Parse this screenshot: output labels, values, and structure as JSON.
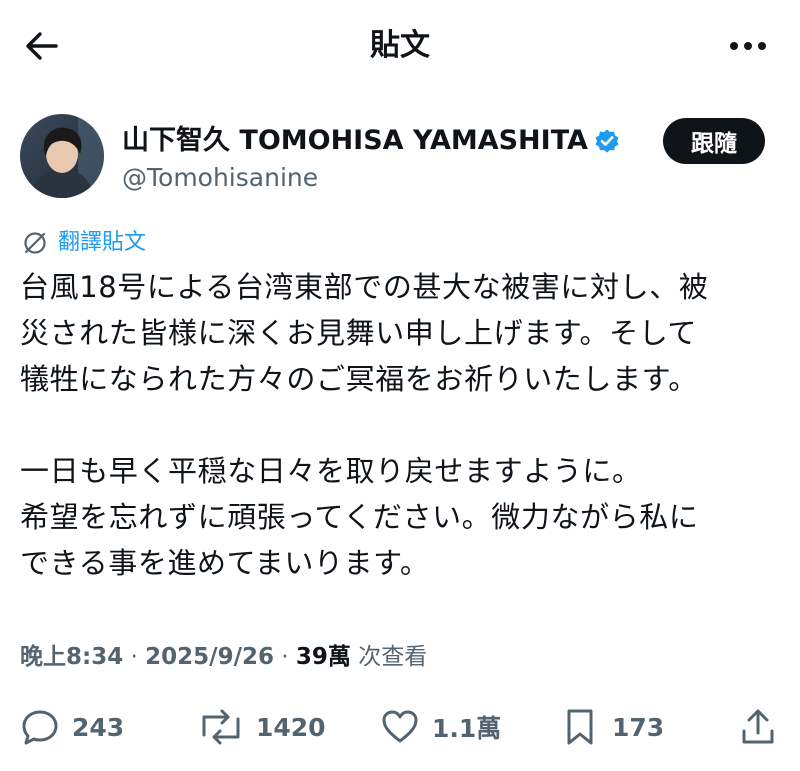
{
  "header": {
    "title": "貼文"
  },
  "author": {
    "display_name": "山下智久 TOMOHISA YAMASHITA",
    "handle": "@Tomohisanine",
    "verified": true,
    "follow_label": "跟隨"
  },
  "translate_label": "翻譯貼文",
  "post": {
    "paragraph_1": "台風18号による台湾東部での甚大な被害に対し、被\n災された皆様に深くお見舞い申し上げます。そして\n犠牲になられた方々のご冥福をお祈りいたします。",
    "paragraph_2": "一日も早く平穏な日々を取り戻せますように。\n希望を忘れずに頑張ってください。微力ながら私に\nできる事を進めてまいります。"
  },
  "meta": {
    "time": "晚上8:34",
    "separator": " · ",
    "date": "2025/9/26",
    "views_count": "39萬",
    "views_label": " 次查看"
  },
  "actions": {
    "replies": "243",
    "reposts": "1420",
    "likes": "1.1萬",
    "bookmarks": "173"
  },
  "colors": {
    "accent": "#1d9bf0",
    "text": "#0f1419",
    "secondary": "#536471"
  },
  "icons": {
    "back": "arrow-left-icon",
    "more": "more-horizontal-icon",
    "verified": "verified-badge-icon",
    "translate": "globe-icon",
    "reply": "reply-icon",
    "repost": "repost-icon",
    "like": "heart-icon",
    "bookmark": "bookmark-icon",
    "share": "share-icon"
  }
}
